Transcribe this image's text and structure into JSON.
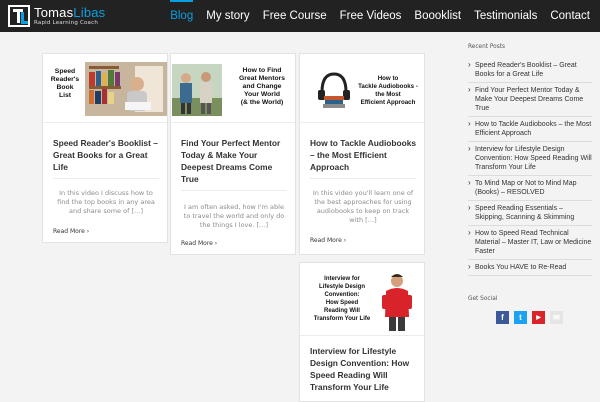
{
  "brand": {
    "first_name": "Tomas",
    "last_name": "Libas",
    "tagline": "Rapid Learning Coach"
  },
  "nav": {
    "items": [
      {
        "label": "Blog",
        "active": true
      },
      {
        "label": "My story"
      },
      {
        "label": "Free Course"
      },
      {
        "label": "Free Videos"
      },
      {
        "label": "Boooklist"
      },
      {
        "label": "Testimonials"
      },
      {
        "label": "Contact"
      }
    ]
  },
  "posts": [
    {
      "thumb_label": "Speed\nReader's\nBook\nList",
      "title": "Speed Reader's Booklist – Great Books for a Great Life",
      "excerpt": "In this video I discuss how to find the top books in any area and share some of […]",
      "read_more": "Read More ›"
    },
    {
      "thumb_label": "How to Find\nGreat Mentors\nand Change\nYour World\n(& the World)",
      "title": "Find Your Perfect Mentor Today & Make Your Deepest Dreams Come True",
      "excerpt": "I am often asked, how I'm able to travel the world and only do the things I love. […]",
      "read_more": "Read More ›"
    },
    {
      "thumb_label": "How to\nTackle Audiobooks -\nthe Most\nEfficient Approach",
      "title": "How to Tackle Audiobooks – the Most Efficient Approach",
      "excerpt": "In this video you'll learn one of the best approaches for using audiobooks to keep on track with […]",
      "read_more": "Read More ›"
    },
    {
      "thumb_label": "Interview for\nLifestyle Design\nConvention:\nHow Speed\nReading Will\nTransform Your Life",
      "title": "Interview for Lifestyle Design Convention: How Speed Reading Will Transform Your Life"
    }
  ],
  "sidebar": {
    "recent_heading": "Recent Posts",
    "recent": [
      "Speed Reader's Booklist – Great Books for a Great Life",
      "Find Your Perfect Mentor Today & Make Your Deepest Dreams Come True",
      "How to Tackle Audiobooks – the Most Efficient Approach",
      "Interview for Lifestyle Design Convention: How Speed Reading Will Transform Your Life",
      "To Mind Map or Not to Mind Map (Books) – RESOLVED",
      "Speed Reading Essentials – Skipping, Scanning & Skimming",
      "How to Speed Read Technical Material – Master IT, Law or Medicine Faster",
      "Books You HAVE to Re-Read"
    ],
    "social_heading": "Get Social",
    "social": [
      {
        "name": "facebook-icon",
        "glyph": "f",
        "color": "#3b5998"
      },
      {
        "name": "twitter-icon",
        "glyph": "t",
        "color": "#1da1f2"
      },
      {
        "name": "youtube-icon",
        "glyph": "▶",
        "color": "#d9252a"
      },
      {
        "name": "email-icon",
        "glyph": "✉",
        "color": "#e5e5e5"
      }
    ]
  },
  "colors": {
    "accent": "#0aa0e0",
    "header_bg": "#222222"
  }
}
